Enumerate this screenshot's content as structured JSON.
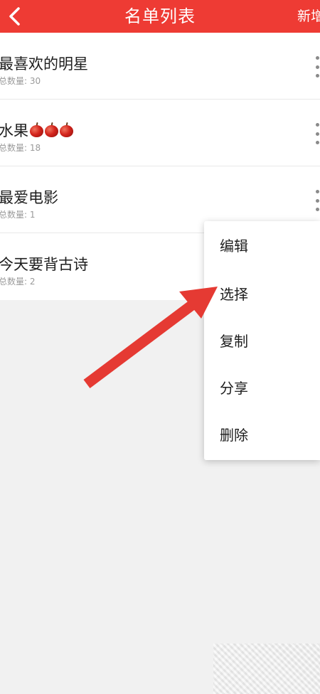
{
  "header": {
    "title": "名单列表",
    "add_label": "新增",
    "background": "#ee3b34"
  },
  "list": [
    {
      "title": "最喜欢的明星",
      "count_label": "总数量: ",
      "count": "30",
      "apples": 0
    },
    {
      "title": "水果",
      "count_label": "总数量: ",
      "count": "18",
      "apples": 3
    },
    {
      "title": "最爱电影",
      "count_label": "总数量: ",
      "count": "1",
      "apples": 0
    },
    {
      "title": "今天要背古诗",
      "count_label": "总数量: ",
      "count": "2",
      "apples": 0
    }
  ],
  "context_menu": {
    "items": [
      "编辑",
      "选择",
      "复制",
      "分享",
      "删除"
    ]
  },
  "annotation": {
    "arrow_color": "#e53a33"
  }
}
